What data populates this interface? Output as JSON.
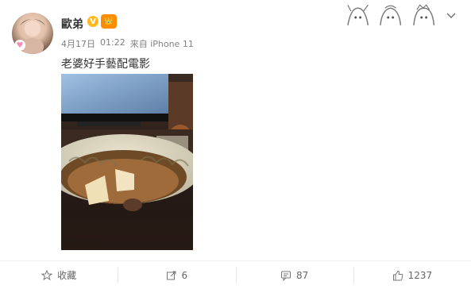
{
  "post": {
    "username": "歐弟",
    "verified_badge": "V",
    "member_badge_icon": "member-crown-icon",
    "meta": {
      "date": "4月17日",
      "time": "01:22",
      "source": "来自 iPhone 11"
    },
    "text": "老婆好手藝配電影",
    "photo_icon": "food-and-tv-photo"
  },
  "actions": {
    "favorite": {
      "label": "收藏",
      "icon": "star-icon"
    },
    "share": {
      "label": "6",
      "icon": "share-icon"
    },
    "comment": {
      "label": "87",
      "icon": "comment-icon"
    },
    "like": {
      "label": "1237",
      "icon": "thumbs-up-icon"
    }
  },
  "colors": {
    "name": "#333333",
    "meta": "#808080",
    "vbadge": "#ffb91e",
    "member": "#ff8b00"
  }
}
